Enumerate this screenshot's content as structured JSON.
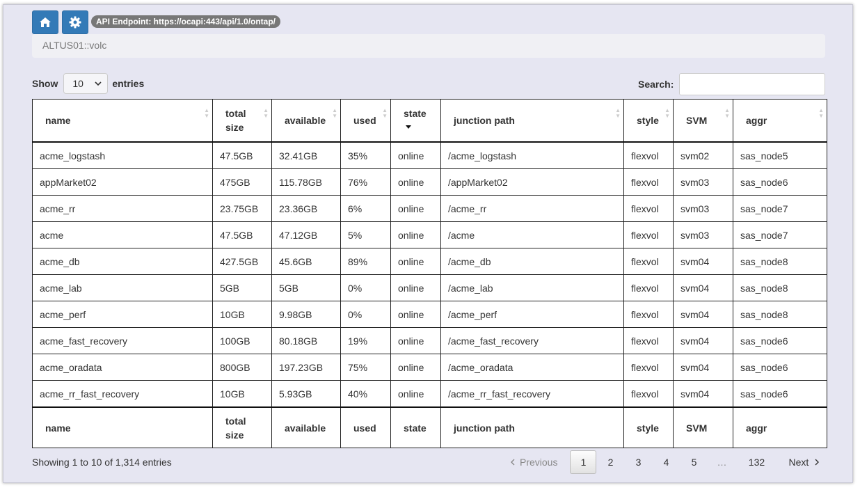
{
  "toolbar": {
    "home_icon": "home-icon",
    "settings_icon": "gear-icon",
    "api_endpoint": "API Endpoint: https://ocapi:443/api/1.0/ontap/",
    "accent": "#337ab7"
  },
  "breadcrumb": {
    "text": "ALTUS01::volc"
  },
  "length": {
    "show": "Show",
    "value": "10",
    "entries": "entries"
  },
  "search": {
    "label": "Search:",
    "value": ""
  },
  "table": {
    "columns": [
      "name",
      "total size",
      "available",
      "used",
      "state",
      "junction path",
      "style",
      "SVM",
      "aggr"
    ],
    "sorted_column": "state",
    "rows": [
      [
        "acme_logstash",
        "47.5GB",
        "32.41GB",
        "35%",
        "online",
        "/acme_logstash",
        "flexvol",
        "svm02",
        "sas_node5"
      ],
      [
        "appMarket02",
        "475GB",
        "115.78GB",
        "76%",
        "online",
        "/appMarket02",
        "flexvol",
        "svm03",
        "sas_node6"
      ],
      [
        "acme_rr",
        "23.75GB",
        "23.36GB",
        "6%",
        "online",
        "/acme_rr",
        "flexvol",
        "svm03",
        "sas_node7"
      ],
      [
        "acme",
        "47.5GB",
        "47.12GB",
        "5%",
        "online",
        "/acme",
        "flexvol",
        "svm03",
        "sas_node7"
      ],
      [
        "acme_db",
        "427.5GB",
        "45.6GB",
        "89%",
        "online",
        "/acme_db",
        "flexvol",
        "svm04",
        "sas_node8"
      ],
      [
        "acme_lab",
        "5GB",
        "5GB",
        "0%",
        "online",
        "/acme_lab",
        "flexvol",
        "svm04",
        "sas_node8"
      ],
      [
        "acme_perf",
        "10GB",
        "9.98GB",
        "0%",
        "online",
        "/acme_perf",
        "flexvol",
        "svm04",
        "sas_node8"
      ],
      [
        "acme_fast_recovery",
        "100GB",
        "80.18GB",
        "19%",
        "online",
        "/acme_fast_recovery",
        "flexvol",
        "svm04",
        "sas_node6"
      ],
      [
        "acme_oradata",
        "800GB",
        "197.23GB",
        "75%",
        "online",
        "/acme_oradata",
        "flexvol",
        "svm04",
        "sas_node6"
      ],
      [
        "acme_rr_fast_recovery",
        "10GB",
        "5.93GB",
        "40%",
        "online",
        "/acme_rr_fast_recovery",
        "flexvol",
        "svm04",
        "sas_node6"
      ]
    ]
  },
  "info": "Showing 1 to 10 of 1,314 entries",
  "pagination": {
    "previous": "Previous",
    "next": "Next",
    "pages": [
      "1",
      "2",
      "3",
      "4",
      "5",
      "…",
      "132"
    ],
    "current": "1"
  }
}
